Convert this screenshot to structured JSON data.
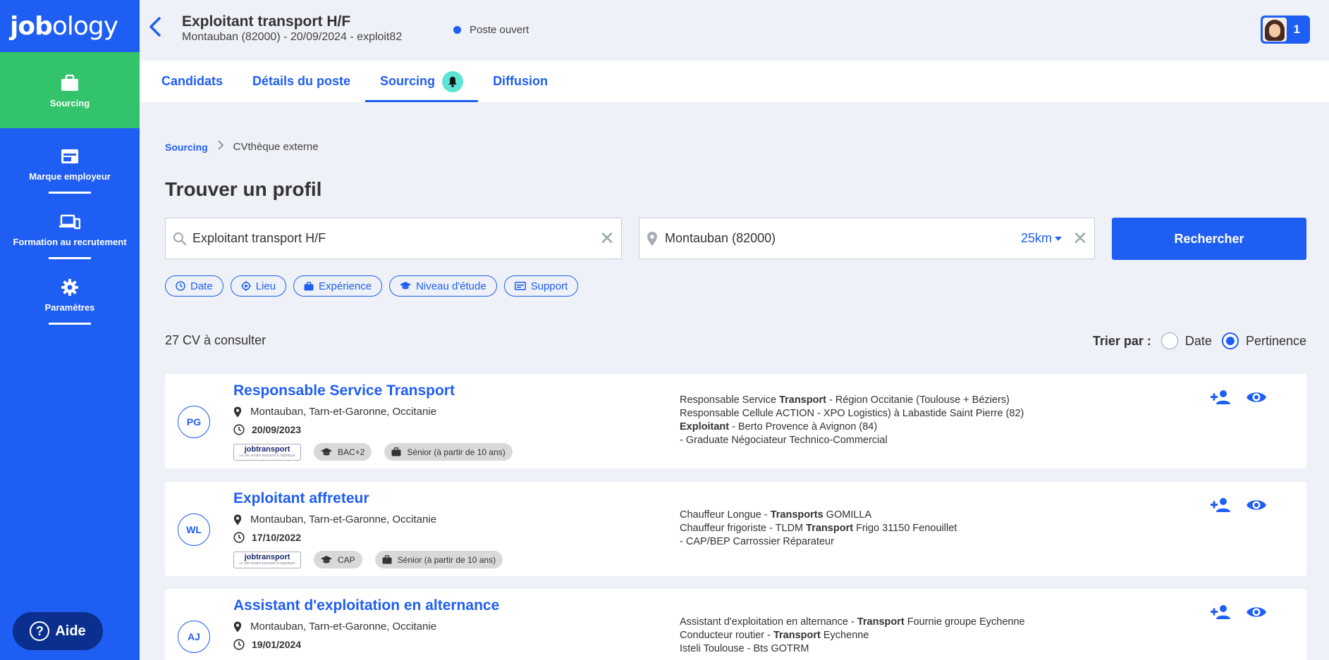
{
  "app": {
    "logo_main": "job",
    "logo_rest": "ology"
  },
  "sidebar": {
    "items": [
      {
        "label": "Sourcing",
        "icon": "briefcase-icon"
      },
      {
        "label": "Marque employeur",
        "icon": "browser-window-icon"
      },
      {
        "label": "Formation au recrutement",
        "icon": "devices-icon"
      },
      {
        "label": "Paramètres",
        "icon": "gear-icon"
      }
    ],
    "help_label": "Aide"
  },
  "header": {
    "title": "Exploitant transport H/F",
    "subtitle": "Montauban (82000) - 20/09/2024 - exploit82",
    "status": "Poste ouvert",
    "notification_count": "1"
  },
  "tabs": [
    {
      "label": "Candidats"
    },
    {
      "label": "Détails du poste"
    },
    {
      "label": "Sourcing"
    },
    {
      "label": "Diffusion"
    }
  ],
  "breadcrumb": {
    "root": "Sourcing",
    "current": "CVthèque externe"
  },
  "page_title": "Trouver un profil",
  "search": {
    "what_value": "Exploitant transport H/F",
    "where_value": "Montauban (82000)",
    "radius": "25km",
    "button": "Rechercher"
  },
  "filters": [
    {
      "label": "Date",
      "icon": "clock-icon"
    },
    {
      "label": "Lieu",
      "icon": "target-icon"
    },
    {
      "label": "Expérience",
      "icon": "briefcase-icon"
    },
    {
      "label": "Niveau d'étude",
      "icon": "graduation-cap-icon"
    },
    {
      "label": "Support",
      "icon": "card-icon"
    }
  ],
  "results": {
    "count_label": "27 CV à consulter",
    "sort_label": "Trier par :",
    "sort_options": [
      "Date",
      "Pertinence"
    ],
    "sort_selected": "Pertinence"
  },
  "cards": [
    {
      "initials": "PG",
      "title": "Responsable Service Transport",
      "location": "Montauban, Tarn-et-Garonne, Occitanie",
      "date": "20/09/2023",
      "source_logo": "jobtransport",
      "source_tagline": "Le site emploi transport & logistique",
      "education": "BAC+2",
      "experience": "Sénior (à partir de 10 ans)",
      "lines": [
        [
          "Responsable Service ",
          "Transport",
          " - Région Occitanie (Toulouse + Béziers)"
        ],
        [
          "Responsable Cellule ACTION - XPO Logistics) à Labastide Saint Pierre (82)",
          "",
          ""
        ],
        [
          "",
          "Exploitant",
          " - Berto Provence à Avignon (84)"
        ],
        [
          "- Graduate Négociateur Technico-Commercial",
          "",
          ""
        ]
      ]
    },
    {
      "initials": "WL",
      "title": "Exploitant affreteur",
      "location": "Montauban, Tarn-et-Garonne, Occitanie",
      "date": "17/10/2022",
      "source_logo": "jobtransport",
      "source_tagline": "Le site emploi transport & logistique",
      "education": "CAP",
      "experience": "Sénior (à partir de 10 ans)",
      "lines": [
        [
          "Chauffeur Longue - ",
          "Transports",
          " GOMILLA"
        ],
        [
          "Chauffeur frigoriste - TLDM ",
          "Transport",
          " Frigo 31150 Fenouillet"
        ],
        [
          "- CAP/BEP Carrossier Réparateur",
          "",
          ""
        ]
      ]
    },
    {
      "initials": "AJ",
      "title": "Assistant d'exploitation en alternance",
      "location": "Montauban, Tarn-et-Garonne, Occitanie",
      "date": "19/01/2024",
      "lines": [
        [
          "Assistant d'exploitation en alternance - ",
          "Transport",
          " Fournie groupe Eychenne"
        ],
        [
          "Conducteur routier - ",
          "Transport",
          " Eychenne"
        ],
        [
          "Isteli Toulouse - Bts GOTRM",
          "",
          ""
        ]
      ]
    }
  ],
  "colors": {
    "primary": "#1f5ef2",
    "active_nav": "#33c46b",
    "help": "#0a2f8e",
    "bell": "#5fe3d4",
    "background": "#eef1f8"
  }
}
